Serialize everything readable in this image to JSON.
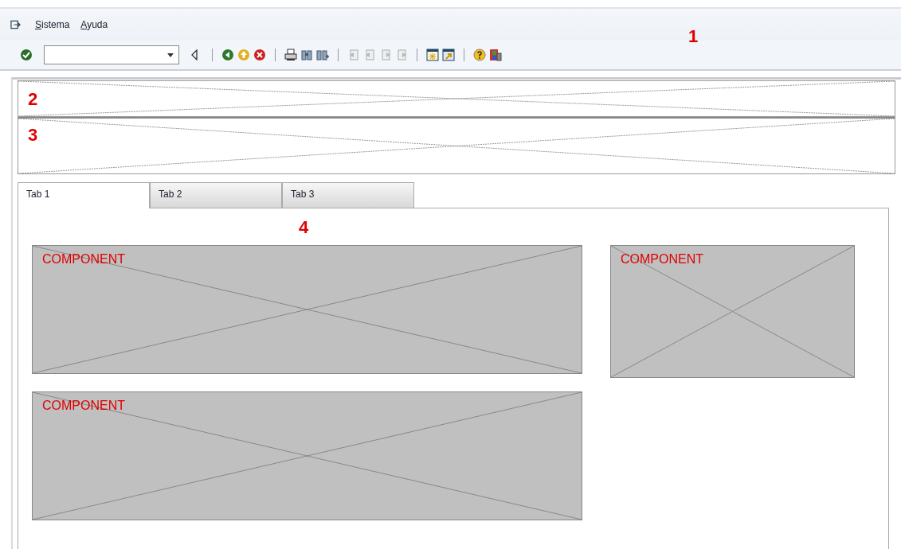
{
  "menu_bar": {
    "items": [
      {
        "label": "Sistema"
      },
      {
        "label": "Ayuda"
      }
    ],
    "marker": "1"
  },
  "header_area": {
    "marker": "2"
  },
  "subheader_area": {
    "marker": "3"
  },
  "tabs": [
    {
      "label": "Tab 1",
      "selected": true
    },
    {
      "label": "Tab 2",
      "selected": false
    },
    {
      "label": "Tab 3",
      "selected": false
    }
  ],
  "tab_panel": {
    "marker": "4",
    "components": [
      {
        "label": "COMPONENT",
        "kind": "wide"
      },
      {
        "label": "COMPONENT",
        "kind": "narrow"
      },
      {
        "label": "COMPONENT",
        "kind": "wide"
      }
    ]
  }
}
